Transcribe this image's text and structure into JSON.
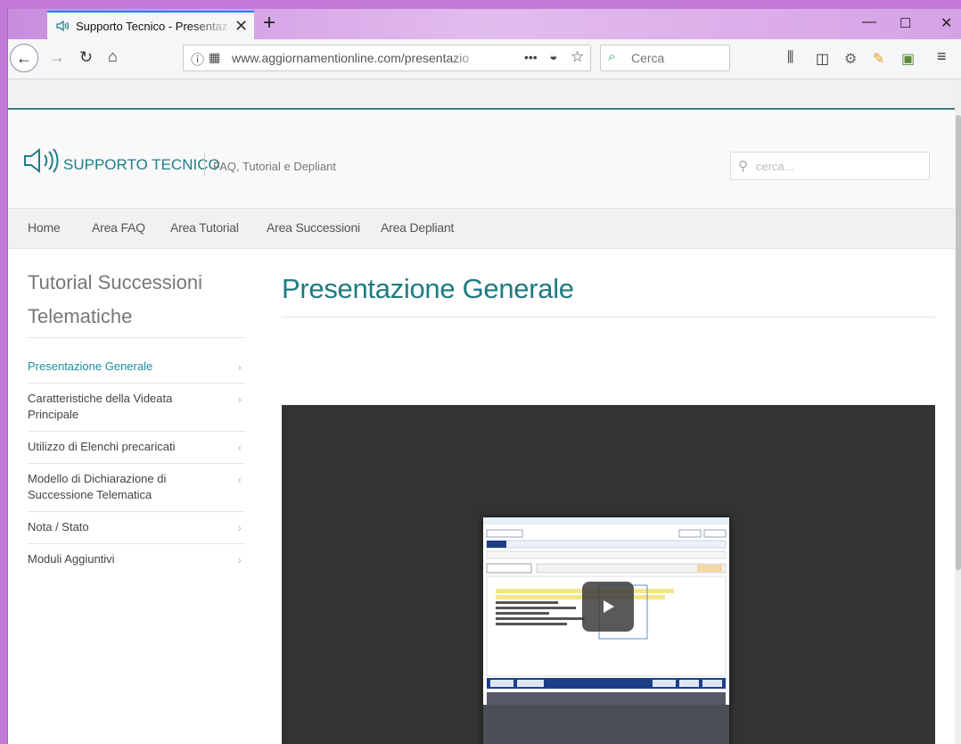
{
  "browser": {
    "tab_title": "Supporto Tecnico - Presentazio",
    "url": "www.aggiornamentionline.com/presentazio",
    "search_placeholder": "Cerca",
    "accent": "#0a84ff"
  },
  "site": {
    "logo_text": "SUPPORTO TECNICO",
    "tagline": "FAQ, Tutorial e Depliant",
    "search_placeholder": "cerca...",
    "brand_color": "#1f7a83"
  },
  "menu": {
    "items": [
      {
        "label": "Home"
      },
      {
        "label": "Area FAQ"
      },
      {
        "label": "Area Tutorial"
      },
      {
        "label": "Area Successioni"
      },
      {
        "label": "Area Depliant"
      }
    ]
  },
  "sidebar": {
    "title": "Tutorial Successioni Telematiche",
    "items": [
      {
        "label": "Presentazione Generale",
        "chevron": "›"
      },
      {
        "label": "Caratteristiche della Videata Principale",
        "chevron": "›"
      },
      {
        "label": "Utilizzo di Elenchi precaricati",
        "chevron": "‹"
      },
      {
        "label": "Modello di Dichiarazione di Successione Telematica",
        "chevron": "‹"
      },
      {
        "label": "Nota / Stato",
        "chevron": "›"
      },
      {
        "label": "Moduli Aggiuntivi",
        "chevron": "›"
      }
    ]
  },
  "main": {
    "title": "Presentazione Generale"
  }
}
